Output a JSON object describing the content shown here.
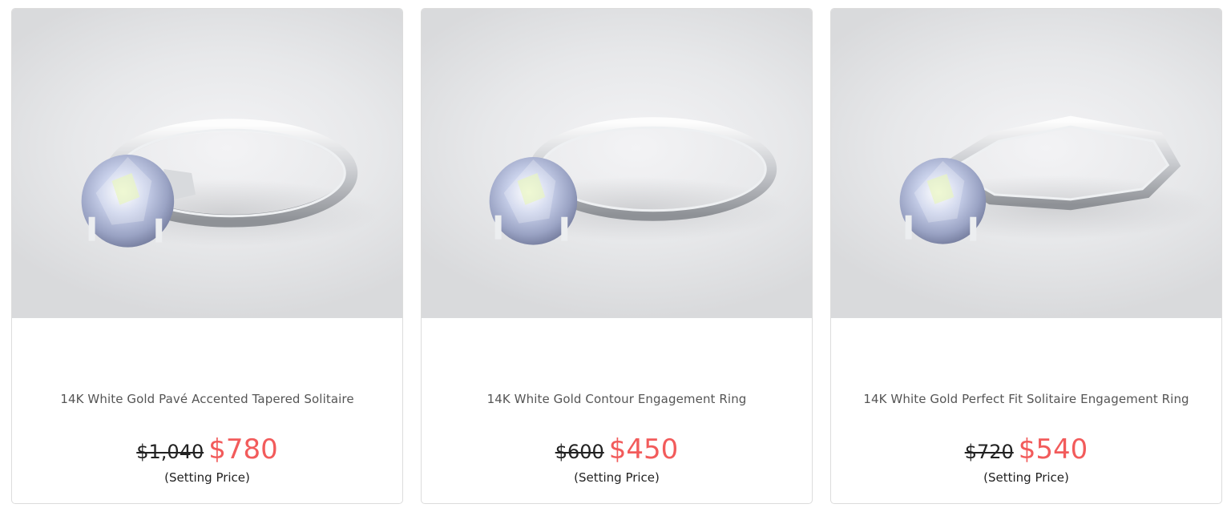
{
  "products": [
    {
      "title": "14K White Gold Pavé Accented Tapered Solitaire",
      "old_price": "$1,040",
      "price": "$780",
      "price_note": "(Setting Price)",
      "image": "solitaire-ring-pave-tapered"
    },
    {
      "title": "14K White Gold Contour Engagement Ring",
      "old_price": "$600",
      "price": "$450",
      "price_note": "(Setting Price)",
      "image": "solitaire-ring-contour"
    },
    {
      "title": "14K White Gold Perfect Fit Solitaire Engagement Ring",
      "old_price": "$720",
      "price": "$540",
      "price_note": "(Setting Price)",
      "image": "solitaire-ring-perfect-fit"
    }
  ],
  "colors": {
    "sale_price": "#f25b5b",
    "old_price": "#222222",
    "title": "#555555",
    "card_border": "#dcdcdc"
  }
}
